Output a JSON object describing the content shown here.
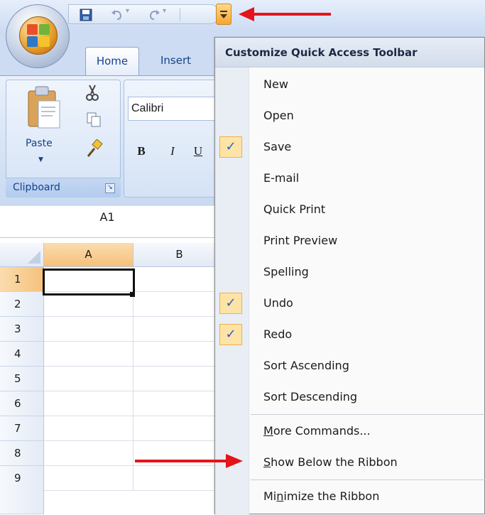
{
  "ribbon": {
    "tabs": [
      {
        "label": "Home",
        "active": true
      },
      {
        "label": "Insert",
        "active": false
      }
    ],
    "font_name": "Calibri",
    "format_buttons": [
      "B",
      "I",
      "U"
    ],
    "clipboard": {
      "paste_label": "Paste",
      "group_label": "Clipboard"
    }
  },
  "quick_access_toolbar": {
    "icons": [
      "save-icon",
      "undo-icon",
      "redo-icon"
    ],
    "customize_icon": "dropdown-icon"
  },
  "name_box": {
    "value": "A1"
  },
  "grid": {
    "columns": [
      "A",
      "B"
    ],
    "rows": [
      "1",
      "2",
      "3",
      "4",
      "5",
      "6",
      "7",
      "8",
      "9"
    ],
    "active_cell": "A1"
  },
  "menu": {
    "header": "Customize Quick Access Toolbar",
    "items": [
      {
        "label": "New",
        "checked": false
      },
      {
        "label": "Open",
        "checked": false
      },
      {
        "label": "Save",
        "checked": true
      },
      {
        "label": "E-mail",
        "checked": false
      },
      {
        "label": "Quick Print",
        "checked": false
      },
      {
        "label": "Print Preview",
        "checked": false
      },
      {
        "label": "Spelling",
        "checked": false
      },
      {
        "label": "Undo",
        "checked": true
      },
      {
        "label": "Redo",
        "checked": true
      },
      {
        "label": "Sort Ascending",
        "checked": false
      },
      {
        "label": "Sort Descending",
        "checked": false
      }
    ],
    "more_commands": {
      "pre": "",
      "accel": "M",
      "post": "ore Commands..."
    },
    "show_below": {
      "pre": "",
      "accel": "S",
      "post": "how Below the Ribbon"
    },
    "minimize": {
      "pre": "Mi",
      "accel": "n",
      "post": "imize the Ribbon"
    },
    "check_glyph": "✓"
  },
  "colors": {
    "annotation_arrow": "#e4141b",
    "check_highlight": "#fde3a6",
    "active_header": "#f6c17a"
  }
}
